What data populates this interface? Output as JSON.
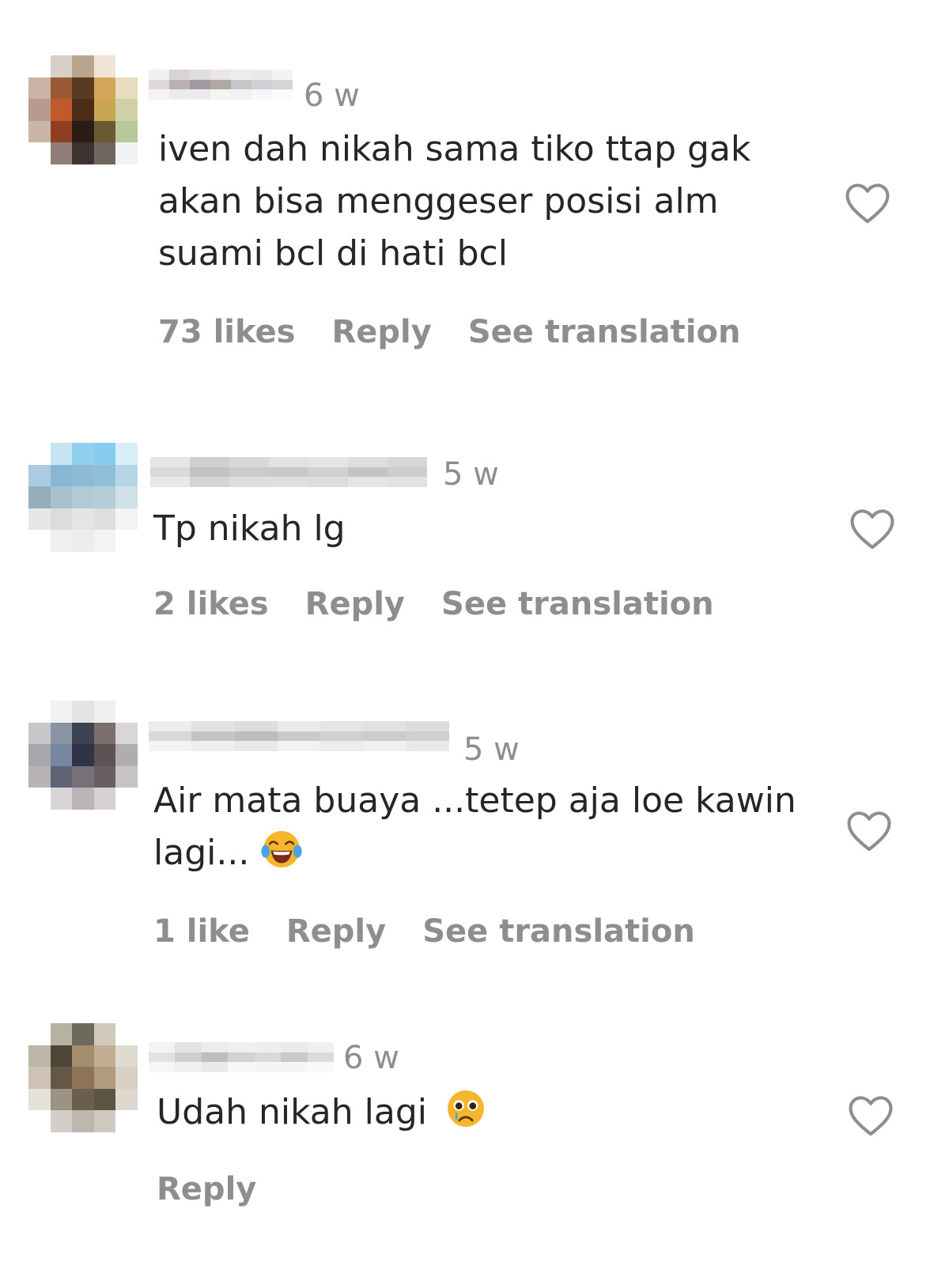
{
  "comments": [
    {
      "time": "6 w",
      "text": "iven dah nikah sama tiko ttap gak akan bisa menggeser posisi alm suami bcl di hati bcl",
      "likes": "73 likes",
      "reply": "Reply",
      "translate": "See translation",
      "avatar_colors": [
        "#ffffff",
        "#d8cfc6",
        "#b9a58d",
        "#efe4d6",
        "#ffffff",
        "#c9b3a5",
        "#9a5a35",
        "#5b3b1f",
        "#d2a55a",
        "#e6dcc0",
        "#b99a8f",
        "#c05a2c",
        "#4a2c17",
        "#c9a654",
        "#cfcfa8",
        "#c9b6a8",
        "#8e3f22",
        "#2a1d16",
        "#6b5a33",
        "#b7c89d",
        "#ffffff",
        "#8f7f78",
        "#3d3431",
        "#6d675f",
        "#f2f2f2"
      ],
      "username_colors": [
        "#f1eeef",
        "#dcd8db",
        "#f4f2f3",
        "#d9d3d6",
        "#bbb0b6",
        "#eceaeb",
        "#e0dde0",
        "#a19aa1",
        "#ecebec",
        "#e9e6e5",
        "#b0a9a3",
        "#f4f4f4",
        "#ededef",
        "#c6c5c9",
        "#f2f2f2",
        "#e8e8ea",
        "#cdd0d4",
        "#f7f7f7",
        "#f3f3f3",
        "#d5d4d7",
        "#fbfbfb"
      ],
      "emoji": ""
    },
    {
      "time": "5 w",
      "text": "Tp nikah lg",
      "likes": "2 likes",
      "reply": "Reply",
      "translate": "See translation",
      "avatar_colors": [
        "#ffffff",
        "#c8e4f2",
        "#8fd0f0",
        "#86ccef",
        "#d8eef8",
        "#aacbe0",
        "#86b8d6",
        "#8ebad6",
        "#90bfd8",
        "#b5d6e6",
        "#96aeb9",
        "#a7c1cd",
        "#b2cad6",
        "#b5cdd8",
        "#cfe0e8",
        "#e6e8e8",
        "#dcdcdc",
        "#e4e4e4",
        "#dedede",
        "#f4f4f4",
        "#ffffff",
        "#f0f0f0",
        "#ececec",
        "#f3f3f3",
        "#ffffff"
      ],
      "username_colors": [
        "#e6e6e6",
        "#dadada",
        "#e8e8e8",
        "#d0d0d0",
        "#c2c2c2",
        "#d4d4d4",
        "#d8d8d8",
        "#cbcbcb",
        "#dedede",
        "#e2e2e2",
        "#c8c8c8",
        "#e0e0e0",
        "#e4e4e4",
        "#d1d1d1",
        "#dcdcdc",
        "#dedede",
        "#c4c4c4",
        "#e6e6e6",
        "#d6d6d6",
        "#cecece",
        "#e2e2e2"
      ],
      "emoji": ""
    },
    {
      "time": "5 w",
      "text": "Air mata buaya ...tetep aja loe kawin lagi...",
      "likes": "1 like",
      "reply": "Reply",
      "translate": "See translation",
      "avatar_colors": [
        "#ffffff",
        "#f2f2f2",
        "#e4e4e4",
        "#efefef",
        "#ffffff",
        "#c9c7c9",
        "#8a93a2",
        "#3b4353",
        "#7d6e6e",
        "#d8d6d7",
        "#a6a8ae",
        "#7688a0",
        "#2f3446",
        "#5e5257",
        "#b1acae",
        "#b8b3b6",
        "#5e6476",
        "#777077",
        "#6a5e61",
        "#c8c4c6",
        "#ffffff",
        "#d9d5d7",
        "#b9b4b6",
        "#d6d2d4",
        "#ffffff"
      ],
      "username_colors": [
        "#ececec",
        "#d9d9d9",
        "#f3f3f3",
        "#e2e2e2",
        "#c4c4c4",
        "#eeeeee",
        "#dddddd",
        "#bdbdbd",
        "#e8e8e8",
        "#eaeaea",
        "#c9c9c9",
        "#f2f2f2",
        "#e5e5e5",
        "#d0d0d0",
        "#ececec",
        "#e1e1e1",
        "#cbcbcb",
        "#f0f0f0",
        "#dcdcdc",
        "#cfcfcf",
        "#e9e9e9"
      ],
      "emoji": "laughing-crying"
    },
    {
      "time": "6 w",
      "text": "Udah nikah lagi",
      "likes": "",
      "reply": "Reply",
      "translate": "",
      "avatar_colors": [
        "#ffffff",
        "#b6b1a3",
        "#6d6a5c",
        "#cfcab9",
        "#ffffff",
        "#bcb6a6",
        "#4d4536",
        "#a58e70",
        "#c1ad91",
        "#e0dbd0",
        "#cdc2b4",
        "#635747",
        "#8e7356",
        "#b29a7c",
        "#d8d0c4",
        "#e5e1db",
        "#9d9384",
        "#6a5e4d",
        "#5e5446",
        "#ddd7ce",
        "#ffffff",
        "#d3cfc8",
        "#bdb7ae",
        "#cfc9c1",
        "#ffffff"
      ],
      "username_colors": [
        "#f3f3f3",
        "#e2e2e2",
        "#f6f6f6",
        "#e4e4e4",
        "#cfcfcf",
        "#f0f0f0",
        "#ececec",
        "#bdbdbd",
        "#e9e9e9",
        "#efefef",
        "#d2d2d2",
        "#f7f7f7",
        "#eeeeee",
        "#d9d9d9",
        "#f4f4f4",
        "#ebebeb",
        "#c9c9c9",
        "#f5f5f5",
        "#f0f0f0",
        "#dbdbdb",
        "#fafafa"
      ],
      "emoji": "pleading-tear"
    }
  ]
}
